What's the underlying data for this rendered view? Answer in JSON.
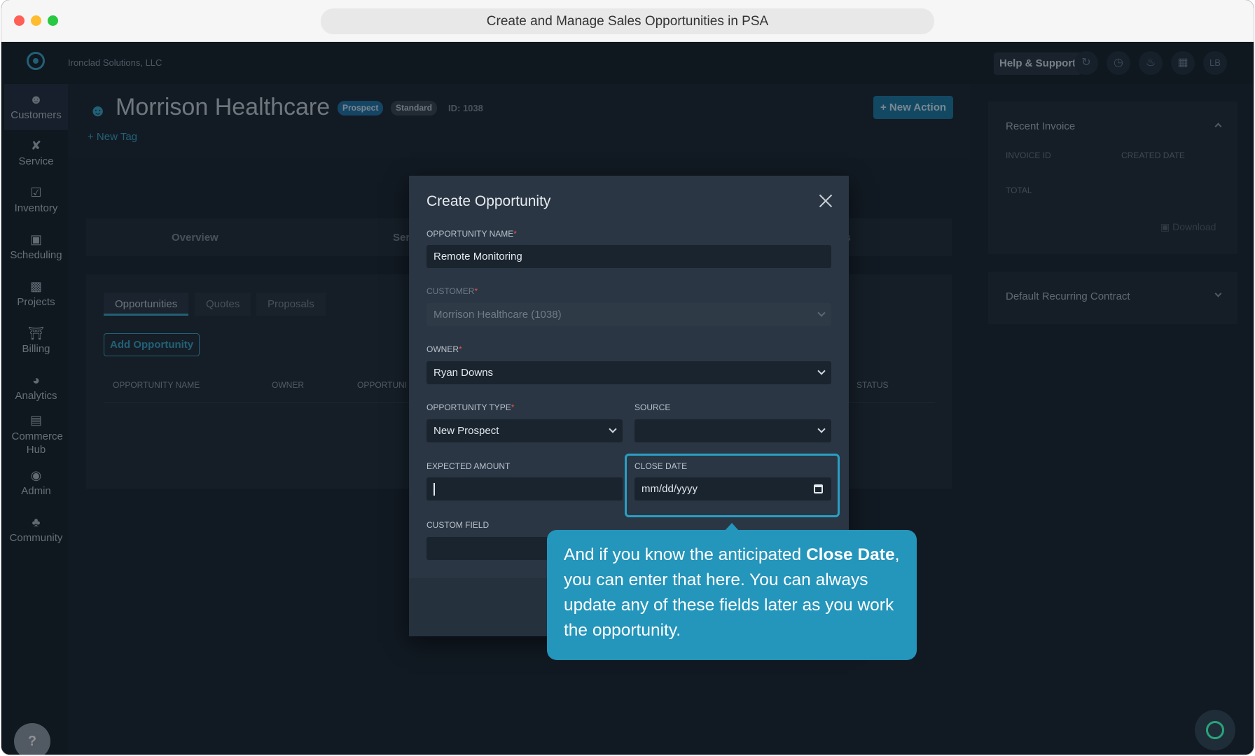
{
  "window": {
    "title": "Create and Manage Sales Opportunities in PSA"
  },
  "topnav": {
    "company": "Ironclad Solutions, LLC",
    "help_label": "Help & Support",
    "avatar_initials": "LB"
  },
  "sidebar": {
    "items": [
      {
        "label": "Customers",
        "icon": "customers-icon"
      },
      {
        "label": "Service",
        "icon": "service-icon"
      },
      {
        "label": "Inventory",
        "icon": "inventory-icon"
      },
      {
        "label": "Scheduling",
        "icon": "calendar-icon"
      },
      {
        "label": "Projects",
        "icon": "projects-icon"
      },
      {
        "label": "Billing",
        "icon": "billing-icon"
      },
      {
        "label": "Analytics",
        "icon": "analytics-icon"
      },
      {
        "label": "Commerce Hub",
        "icon": "commerce-icon"
      },
      {
        "label": "Admin",
        "icon": "admin-icon"
      },
      {
        "label": "Community",
        "icon": "community-icon"
      }
    ],
    "help": "?"
  },
  "customer": {
    "name": "Morrison Healthcare",
    "badge_prospect": "Prospect",
    "badge_standard": "Standard",
    "id": "ID: 1038",
    "new_action": "+ New Action",
    "new_tag": "+ New Tag"
  },
  "tabs": {
    "overview": "Overview",
    "service_partial": "Serv",
    "last_partial": "es"
  },
  "opportunities": {
    "subtabs": [
      "Opportunities",
      "Quotes",
      "Proposals"
    ],
    "add_button": "Add Opportunity",
    "columns": {
      "name": "OPPORTUNITY NAME",
      "owner": "OWNER",
      "opp_partial": "OPPORTUNI",
      "status": "STATUS"
    }
  },
  "right_panel": {
    "recent_invoice": "Recent Invoice",
    "invoice_id": "INVOICE ID",
    "created_date": "CREATED DATE",
    "total": "TOTAL",
    "download": "Download",
    "recurring_contract": "Default Recurring Contract"
  },
  "modal": {
    "title": "Create Opportunity",
    "opportunity_name_label": "OPPORTUNITY NAME",
    "opportunity_name_value": "Remote Monitoring",
    "customer_label": "CUSTOMER",
    "customer_value": "Morrison Healthcare (1038)",
    "owner_label": "OWNER",
    "owner_value": "Ryan Downs",
    "type_label": "OPPORTUNITY TYPE",
    "type_value": "New Prospect",
    "source_label": "SOURCE",
    "source_value": "",
    "amount_label": "EXPECTED AMOUNT",
    "amount_value": "",
    "close_date_label": "CLOSE DATE",
    "close_date_placeholder": "mm/dd/yyyy",
    "custom_field_label": "CUSTOM FIELD",
    "required_mark": "*"
  },
  "tooltip": {
    "part1": "And if you know the anticipated ",
    "bold": "Close Date",
    "part2": ", you can enter that here. You can always update any of these fields later as you work the opportunity."
  },
  "colors": {
    "accent": "#3aa6c8",
    "tooltip": "#2495bb",
    "background": "#1b2631"
  }
}
